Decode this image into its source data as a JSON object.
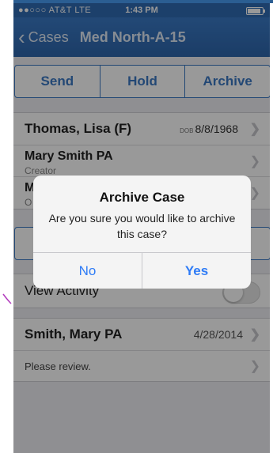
{
  "status_bar": {
    "carrier": "●●○○○ AT&T  LTE",
    "time": "1:43 PM"
  },
  "nav": {
    "back_label": "Cases",
    "title": "Med North-A-15"
  },
  "actions": {
    "send": "Send",
    "hold": "Hold",
    "archive": "Archive"
  },
  "patient": {
    "name": "Thomas, Lisa (F)",
    "dob_label": "DOB",
    "dob": "8/8/1968"
  },
  "rows": [
    {
      "primary": "Mary Smith PA",
      "secondary": "Creator"
    },
    {
      "primary": "M",
      "secondary": "O"
    }
  ],
  "activity": {
    "label": "View Activity",
    "enabled": false
  },
  "comment": {
    "author": "Smith, Mary PA",
    "date": "4/28/2014",
    "text": "Please review."
  },
  "dialog": {
    "title": "Archive Case",
    "message": "Are you sure you would like to archive this case?",
    "no": "No",
    "yes": "Yes"
  },
  "colors": {
    "nav_blue": "#2f6bb3",
    "tint": "#3b78c3",
    "alert_button": "#2f7cf6"
  }
}
